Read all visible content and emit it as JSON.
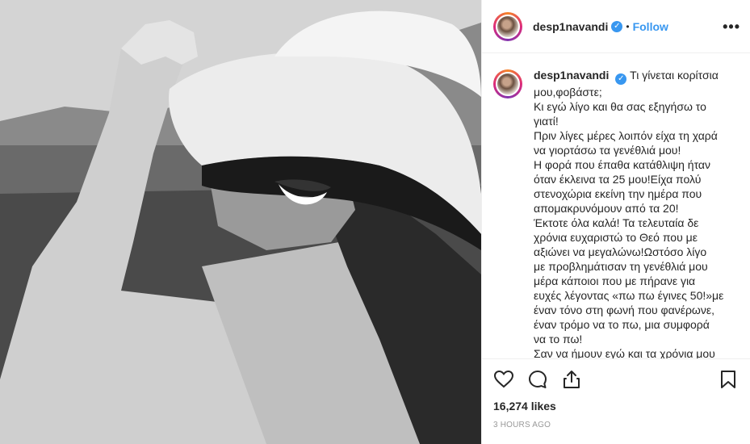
{
  "post": {
    "username": "desp1navandi",
    "follow_label": "Follow",
    "separator": "•",
    "more_icon": "more-options-icon",
    "verified_icon": "verified-badge-icon"
  },
  "caption": {
    "username": "desp1navandi",
    "lines": [
      "Τι γίνεται κορίτσια",
      "μου,φοβάστε;",
      "Κι εγώ λίγο και θα σας εξηγήσω το",
      "γιατί!",
      "Πριν λίγες μέρες λοιπόν είχα τη χαρά",
      "να γιορτάσω τα γενέθλιά μου!",
      "Η φορά που έπαθα κατάθλιψη ήταν",
      "όταν έκλεινα τα 25 μου!Είχα πολύ",
      "στενοχώρια εκείνη την ημέρα που",
      "απομακρυνόμουν από τα 20!",
      "Έκτοτε όλα καλά! Τα τελευταία δε",
      "χρόνια ευχαριστώ το Θεό που με",
      "αξιώνει να μεγαλώνω!Ωστόσο λίγο",
      "με προβλημάτισαν τη γενέθλιά μου",
      "μέρα κάποιοι που με πήρανε για",
      "ευχές λέγοντας «πω πω έγινες 50!»με",
      "έναν τόνο στη φωνή που φανέρωνε,",
      "έναν τρόμο να το πω, μια συμφορά",
      "να το πω!",
      "Σαν να ήμουν εγώ και τα χρόνια μου"
    ]
  },
  "actions": {
    "like_icon": "heart-icon",
    "comment_icon": "comment-icon",
    "share_icon": "share-icon",
    "save_icon": "bookmark-icon"
  },
  "likes": "16,274 likes",
  "timestamp": "3 HOURS AGO"
}
